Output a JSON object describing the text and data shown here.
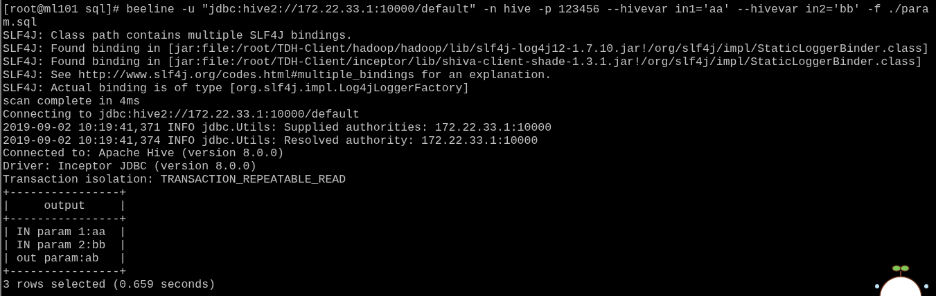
{
  "terminal": {
    "lines": [
      "[root@ml101 sql]# beeline -u \"jdbc:hive2://172.22.33.1:10000/default\" -n hive -p 123456 --hivevar in1='aa' --hivevar in2='bb' -f ./para",
      "m.sql",
      "SLF4J: Class path contains multiple SLF4J bindings.",
      "SLF4J: Found binding in [jar:file:/root/TDH-Client/hadoop/hadoop/lib/slf4j-log4j12-1.7.10.jar!/org/slf4j/impl/StaticLoggerBinder.class]",
      "SLF4J: Found binding in [jar:file:/root/TDH-Client/inceptor/lib/shiva-client-shade-1.3.1.jar!/org/slf4j/impl/StaticLoggerBinder.class]",
      "SLF4J: See http://www.slf4j.org/codes.html#multiple_bindings for an explanation.",
      "SLF4J: Actual binding is of type [org.slf4j.impl.Log4jLoggerFactory]",
      "scan complete in 4ms",
      "Connecting to jdbc:hive2://172.22.33.1:10000/default",
      "2019-09-02 10:19:41,371 INFO jdbc.Utils: Supplied authorities: 172.22.33.1:10000",
      "2019-09-02 10:19:41,374 INFO jdbc.Utils: Resolved authority: 172.22.33.1:10000",
      "Connected to: Apache Hive (version 8.0.0)",
      "Driver: Inceptor JDBC (version 8.0.0)",
      "Transaction isolation: TRANSACTION_REPEATABLE_READ",
      "+----------------+",
      "|     output     |",
      "+----------------+",
      "| IN param 1:aa  |",
      "| IN param 2:bb  |",
      "| out param:ab   |",
      "+----------------+",
      "3 rows selected (0.659 seconds)"
    ]
  }
}
